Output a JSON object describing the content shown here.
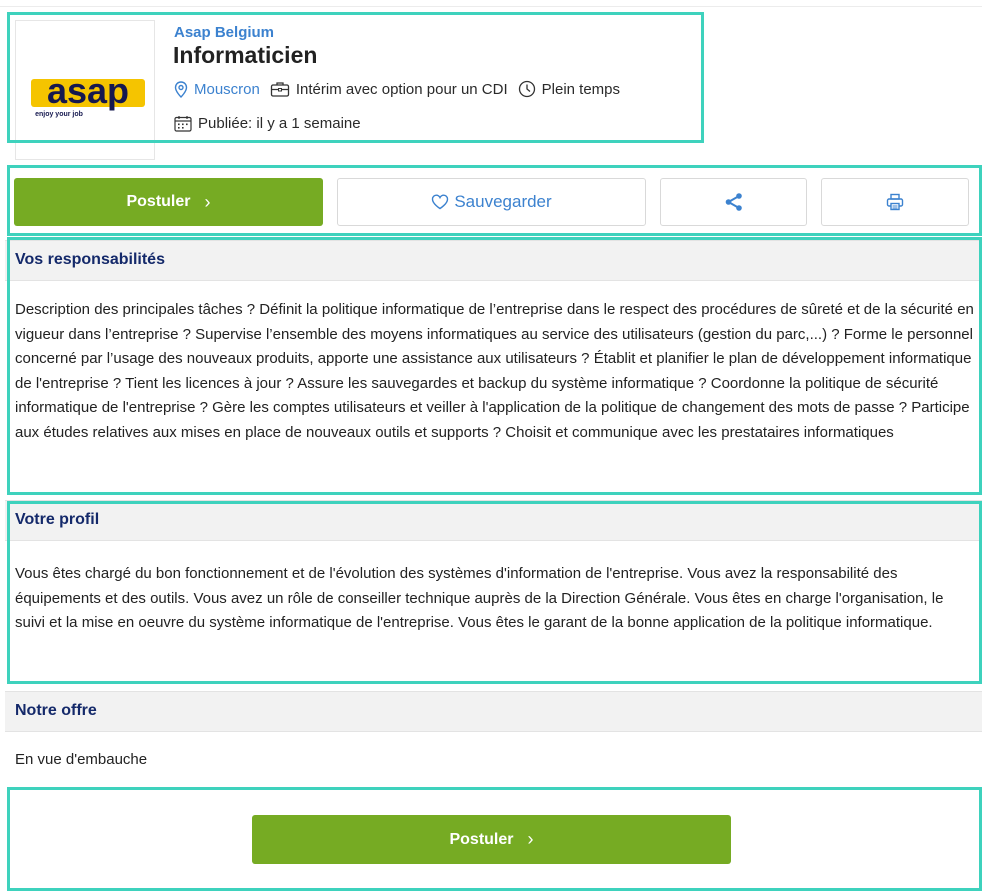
{
  "colors": {
    "accent": "#76ab23",
    "link": "#3c82cf",
    "heading": "#14296a",
    "highlight": "#3ed2bd",
    "logo_yellow": "#f5c400"
  },
  "logo": {
    "wordmark": "asap",
    "tagline": "enjoy your job"
  },
  "job": {
    "company": "Asap Belgium",
    "title": "Informaticien",
    "location": "Mouscron",
    "contract": "Intérim avec option pour un CDI",
    "schedule": "Plein temps",
    "published": "Publiée: il y a 1 semaine"
  },
  "actions": {
    "apply_label": "Postuler",
    "apply_chevron": "›",
    "save_label": "Sauvegarder",
    "share_icon": "share-icon",
    "print_icon": "print-icon"
  },
  "sections": {
    "responsibilities": {
      "heading": "Vos responsabilités",
      "body": "Description des principales tâches ? Définit la politique informatique de l’entreprise dans le respect des procédures de sûreté et de la sécurité en vigueur dans l’entreprise ? Supervise l’ensemble des moyens informatiques au service des utilisateurs (gestion du parc,...) ? Forme le personnel concerné par l’usage des nouveaux produits, apporte une assistance aux utilisateurs ? Établit et planifier le plan de développement informatique de l'entreprise ? Tient les licences à jour ? Assure les sauvegardes et backup du système informatique ? Coordonne la politique de sécurité informatique de l'entreprise ? Gère les comptes utilisateurs et veiller à l'application de la politique de changement des mots de passe ? Participe aux études relatives aux mises en place de nouveaux outils et supports ? Choisit et communique avec les prestataires informatiques"
    },
    "profile": {
      "heading": "Votre profil",
      "body": "Vous êtes chargé du bon fonctionnement et de l'évolution des systèmes d'information de l'entreprise. Vous avez la responsabilité des équipements et des outils. Vous avez un rôle de conseiller technique auprès de la Direction Générale. Vous êtes en charge l'organisation, le suivi et la mise en oeuvre du système informatique de l'entreprise. Vous êtes le garant de la bonne application de la politique informatique."
    },
    "offer": {
      "heading": "Notre offre",
      "body": "En vue d'embauche"
    }
  }
}
